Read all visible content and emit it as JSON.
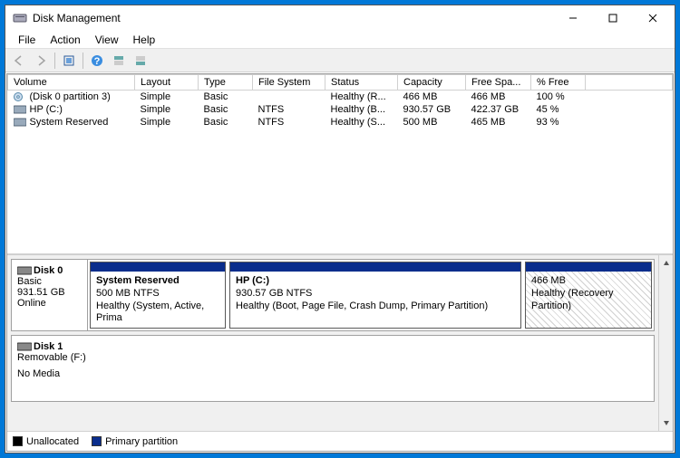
{
  "title": "Disk Management",
  "menu": [
    "File",
    "Action",
    "View",
    "Help"
  ],
  "columns": [
    "Volume",
    "Layout",
    "Type",
    "File System",
    "Status",
    "Capacity",
    "Free Spa...",
    "% Free"
  ],
  "volumes": [
    {
      "icon": "cd",
      "name": "(Disk 0 partition 3)",
      "layout": "Simple",
      "type": "Basic",
      "fs": "",
      "status": "Healthy (R...",
      "capacity": "466 MB",
      "free": "466 MB",
      "pct": "100 %"
    },
    {
      "icon": "hdd",
      "name": "HP (C:)",
      "layout": "Simple",
      "type": "Basic",
      "fs": "NTFS",
      "status": "Healthy (B...",
      "capacity": "930.57 GB",
      "free": "422.37 GB",
      "pct": "45 %"
    },
    {
      "icon": "hdd",
      "name": "System Reserved",
      "layout": "Simple",
      "type": "Basic",
      "fs": "NTFS",
      "status": "Healthy (S...",
      "capacity": "500 MB",
      "free": "465 MB",
      "pct": "93 %"
    }
  ],
  "disk0": {
    "name": "Disk 0",
    "type": "Basic",
    "size": "931.51 GB",
    "state": "Online",
    "p0": {
      "name": "System Reserved",
      "size": "500 MB NTFS",
      "status": "Healthy (System, Active, Prima"
    },
    "p1": {
      "name": "HP  (C:)",
      "size": "930.57 GB NTFS",
      "status": "Healthy (Boot, Page File, Crash Dump, Primary Partition)"
    },
    "p2": {
      "name": "",
      "size": "466 MB",
      "status": "Healthy (Recovery Partition)"
    }
  },
  "disk1": {
    "name": "Disk 1",
    "type": "Removable (F:)",
    "state": "No Media"
  },
  "legend": {
    "unallocated": "Unallocated",
    "primary": "Primary partition"
  },
  "colors": {
    "primary_stripe": "#0a2d8c"
  }
}
